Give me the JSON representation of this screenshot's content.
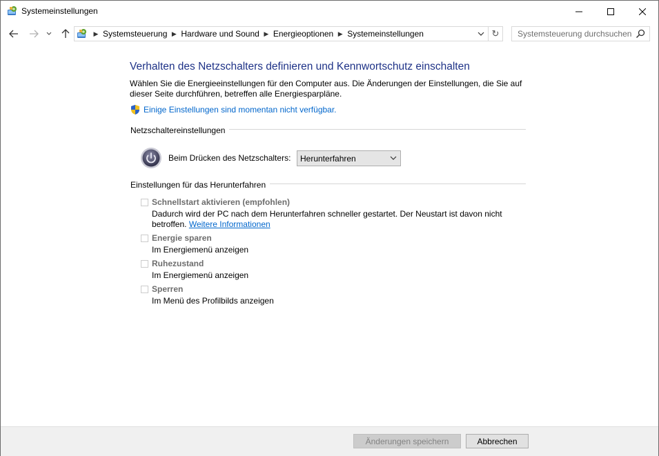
{
  "window": {
    "title": "Systemeinstellungen",
    "controls": {
      "minimize": "minimize",
      "maximize": "maximize",
      "close": "close"
    }
  },
  "nav": {
    "breadcrumbs": [
      "Systemsteuerung",
      "Hardware und Sound",
      "Energieoptionen",
      "Systemeinstellungen"
    ],
    "search_placeholder": "Systemsteuerung durchsuchen"
  },
  "content": {
    "heading": "Verhalten des Netzschalters definieren und Kennwortschutz einschalten",
    "description": "Wählen Sie die Energieeinstellungen für den Computer aus. Die Änderungen der Einstellungen, die Sie auf dieser Seite durchführen, betreffen alle Energiesparpläne.",
    "unavailable_link": "Einige Einstellungen sind momentan nicht verfügbar.",
    "power_section": {
      "label": "Netzschaltereinstellungen",
      "power_button_label": "Beim Drücken des Netzschalters:",
      "power_button_value": "Herunterfahren"
    },
    "shutdown_section": {
      "label": "Einstellungen für das Herunterfahren",
      "options": [
        {
          "title": "Schnellstart aktivieren (empfohlen)",
          "desc": "Dadurch wird der PC nach dem Herunterfahren schneller gestartet. Der Neustart ist davon nicht betroffen.",
          "link": "Weitere Informationen",
          "checked": false
        },
        {
          "title": "Energie sparen",
          "desc": "Im Energiemenü anzeigen",
          "checked": false
        },
        {
          "title": "Ruhezustand",
          "desc": "Im Energiemenü anzeigen",
          "checked": false
        },
        {
          "title": "Sperren",
          "desc": "Im Menü des Profilbilds anzeigen",
          "checked": false
        }
      ]
    }
  },
  "buttons": {
    "save": "Änderungen speichern",
    "cancel": "Abbrechen"
  },
  "colors": {
    "heading": "#1e3287",
    "link": "#0066cc",
    "disabled_text": "#6d6d6d",
    "bottom_bar": "#f0f0f0"
  }
}
